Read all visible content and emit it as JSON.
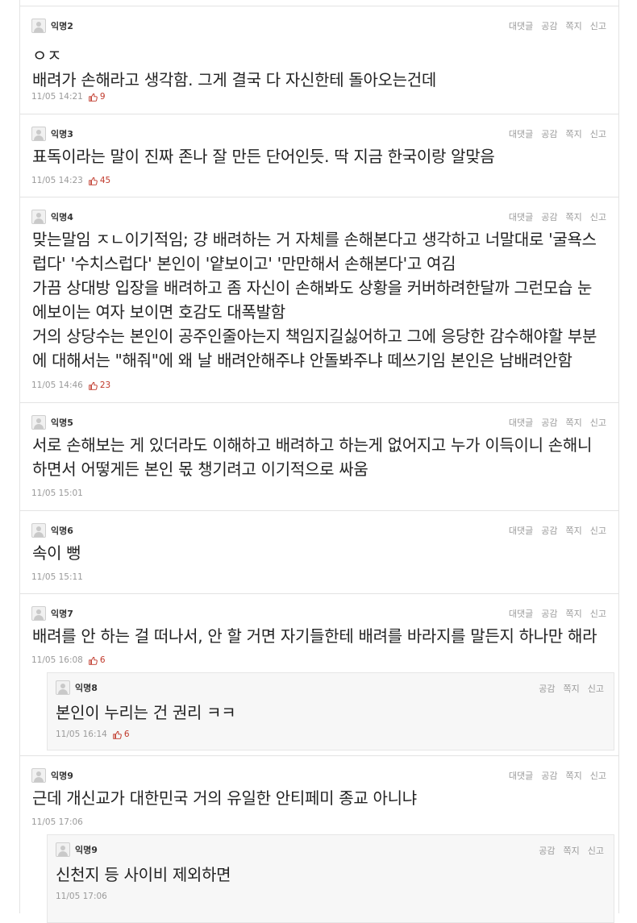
{
  "actions": {
    "reply": "대댓글",
    "like": "공감",
    "message": "쪽지",
    "report": "신고"
  },
  "comments": [
    {
      "author": "익명2",
      "text": "ㅇㅈ\n배려가 손해라고 생각함. 그게 결국 다 자신한테 돌아오는건데",
      "time": "11/05 14:21",
      "likes": "9"
    },
    {
      "author": "익명3",
      "text": "표독이라는 말이 진짜 존나 잘 만든 단어인듯. 딱 지금 한국이랑 알맞음",
      "time": "11/05 14:23",
      "likes": "45"
    },
    {
      "author": "익명4",
      "text": "맞는말임 ㅈㄴ이기적임; 걍 배려하는 거 자체를 손해본다고 생각하고 너말대로 '굴욕스\n럽다' '수치스럽다' 본인이 '얕보이고' '만만해서 손해본다'고 여김\n가끔 상대방 입장을 배려하고 좀 자신이 손해봐도 상황을 커버하려한달까 그런모습 눈\n에보이는 여자 보이면 호감도 대폭발함\n거의 상당수는 본인이 공주인줄아는지 책임지길싫어하고 그에 응당한 감수해야할 부분\n에 대해서는 \"해줘\"에 왜 날 배려안해주냐 안돌봐주냐 떼쓰기임 본인은 남배려안함",
      "time": "11/05 14:46",
      "likes": "23"
    },
    {
      "author": "익명5",
      "text": "서로 손해보는 게 있더라도 이해하고 배려하고 하는게 없어지고 누가 이득이니 손해니\n하면서 어떻게든 본인 몫 챙기려고 이기적으로 싸움",
      "time": "11/05 15:01",
      "likes": ""
    },
    {
      "author": "익명6",
      "text": "속이 뻥",
      "time": "11/05 15:11",
      "likes": ""
    },
    {
      "author": "익명7",
      "text": "배려를 안 하는 걸 떠나서, 안 할 거면 자기들한테 배려를 바라지를 말든지 하나만 해라",
      "time": "11/05 16:08",
      "likes": "6"
    },
    {
      "author": "익명9",
      "text": "근데 개신교가 대한민국 거의 유일한 안티페미 종교 아니냐",
      "time": "11/05 17:06",
      "likes": ""
    }
  ],
  "replies": [
    {
      "author": "익명8",
      "text": "본인이 누리는 건 권리 ㅋㅋ",
      "time": "11/05 16:14",
      "likes": "6"
    },
    {
      "author": "익명9",
      "text": "신천지 등 사이비 제외하면",
      "time": "11/05 17:06",
      "likes": ""
    }
  ]
}
